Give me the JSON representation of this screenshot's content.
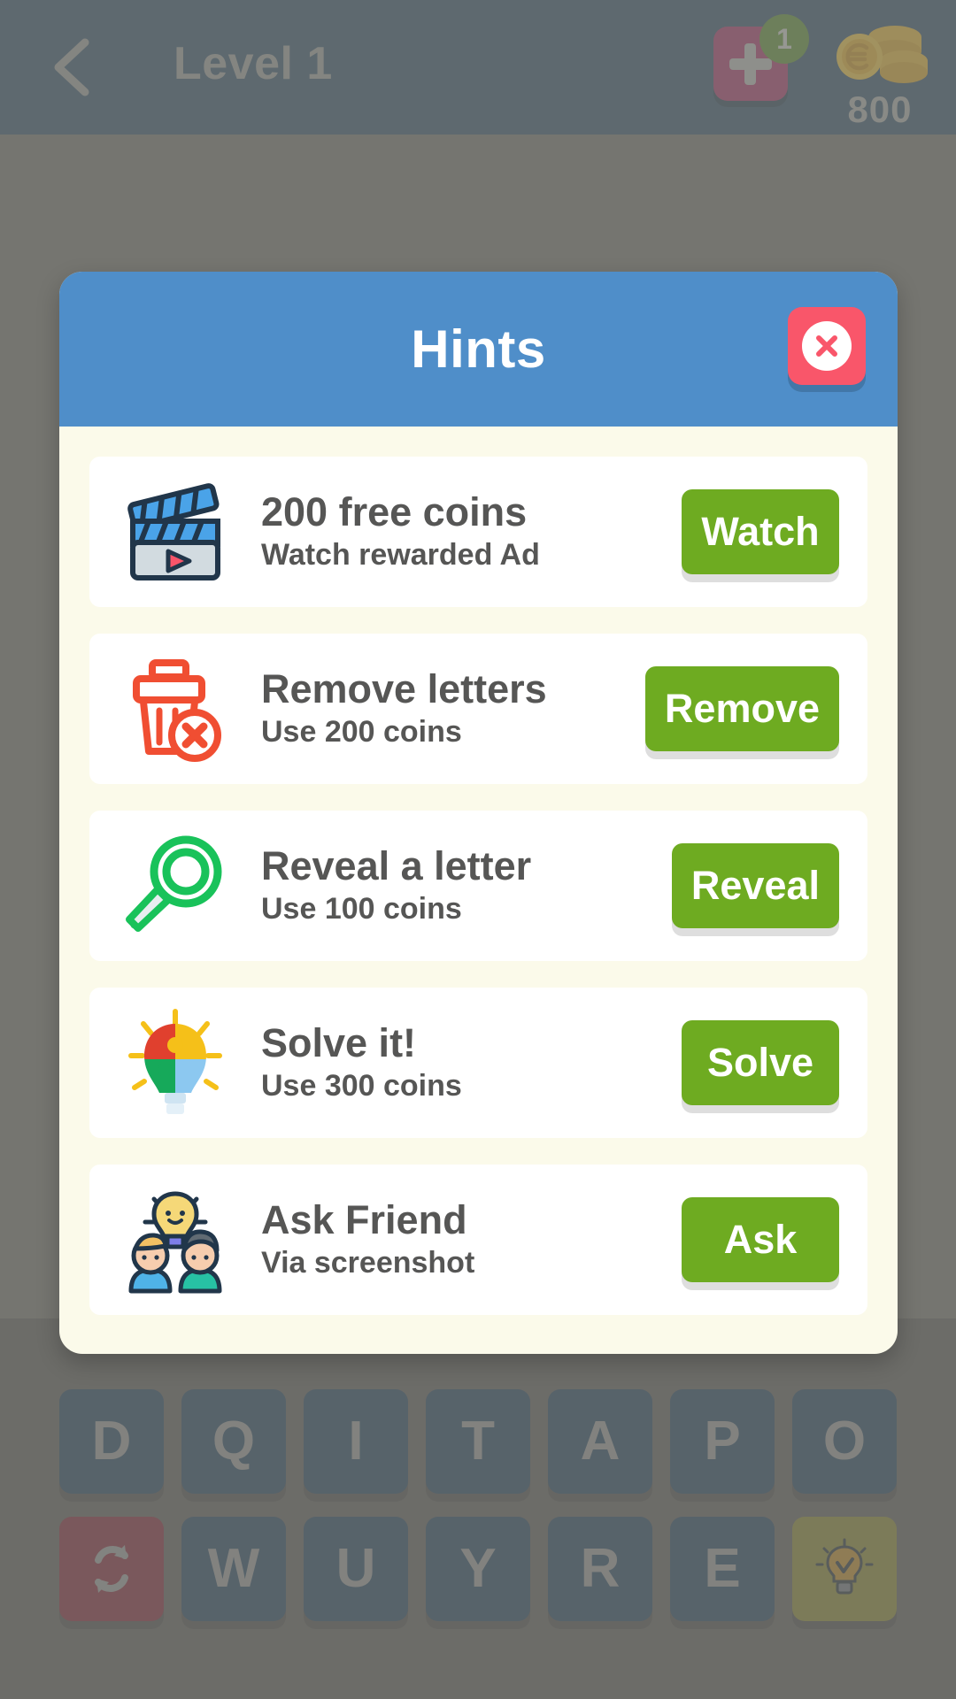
{
  "topbar": {
    "back_icon": "chevron-left-icon",
    "title": "Level 1",
    "add_button_icon": "plus-icon",
    "add_badge_count": "1",
    "coin_icon": "coin-stack-icon",
    "coin_count": "800"
  },
  "dialog": {
    "title": "Hints",
    "close_icon": "close-icon",
    "hints": [
      {
        "icon": "clapperboard-icon",
        "title": "200 free coins",
        "subtitle": "Watch rewarded Ad",
        "action_label": "Watch"
      },
      {
        "icon": "trash-remove-icon",
        "title": "Remove letters",
        "subtitle": "Use 200 coins",
        "action_label": "Remove"
      },
      {
        "icon": "magnifier-icon",
        "title": "Reveal a letter",
        "subtitle": "Use 100 coins",
        "action_label": "Reveal"
      },
      {
        "icon": "puzzle-bulb-icon",
        "title": "Solve it!",
        "subtitle": "Use 300 coins",
        "action_label": "Solve"
      },
      {
        "icon": "friends-bulb-icon",
        "title": "Ask Friend",
        "subtitle": "Via screenshot",
        "action_label": "Ask"
      }
    ]
  },
  "keyboard": {
    "row1": [
      "D",
      "Q",
      "I",
      "T",
      "A",
      "P",
      "O"
    ],
    "row2_letters": [
      "W",
      "U",
      "Y",
      "R",
      "E"
    ],
    "shuffle_icon": "shuffle-icon",
    "hint_icon": "lightbulb-icon"
  },
  "colors": {
    "topbar": "#2c4c68",
    "dialog_header": "#4f8ec9",
    "dialog_body": "#fbfaea",
    "action_green": "#6eab21",
    "close_red": "#f9566a",
    "add_pink": "#a83166",
    "badge_green": "#588c2c",
    "key_blue": "#2b5074",
    "key_shuffle_red": "#9e2d40",
    "key_hint_olive": "#a6a13a"
  }
}
